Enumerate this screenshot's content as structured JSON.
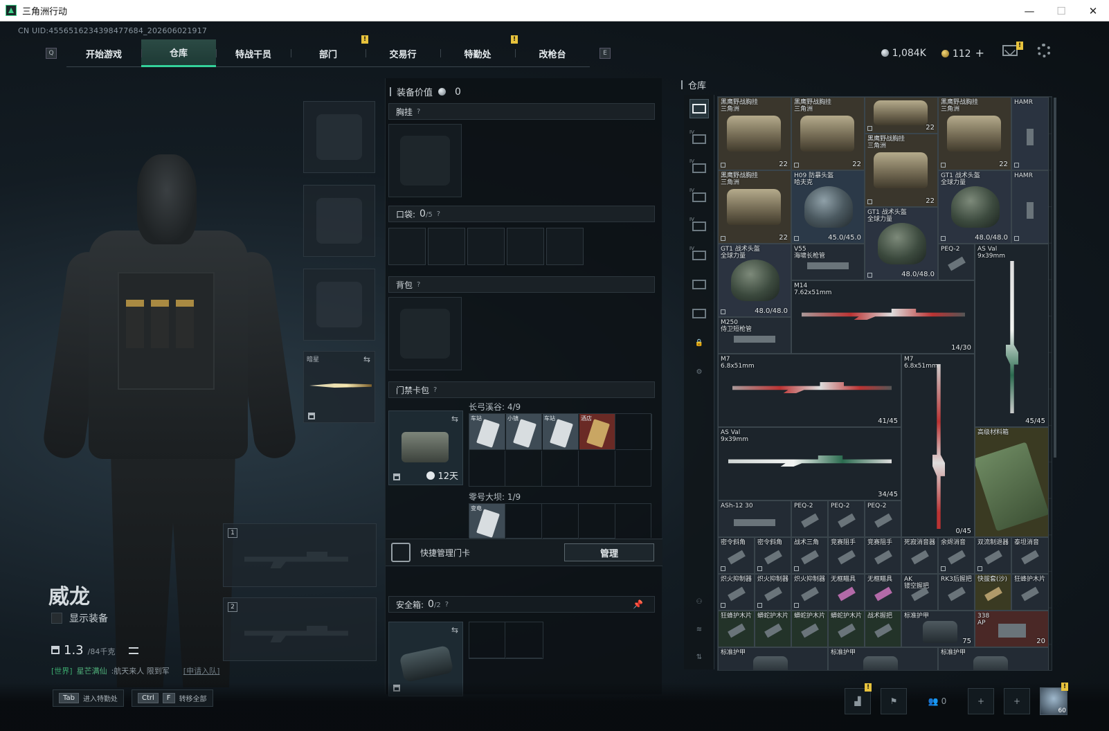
{
  "window": {
    "title": "三角洲行动",
    "minimize": "—",
    "maximize": "☐",
    "close": "✕"
  },
  "uid": "CN UID:4556516234398477684_202606021917",
  "nav": {
    "left_key": "Q",
    "right_key": "E",
    "tabs": [
      "开始游戏",
      "仓库",
      "特战干员",
      "部门",
      "交易行",
      "特勤处",
      "改枪台"
    ],
    "active_tab": "仓库",
    "badge": "!"
  },
  "currency": {
    "silver": "1,084K",
    "gold": "112",
    "plus": "+"
  },
  "operator": {
    "name": "威龙",
    "show_gear_label": "显示装备",
    "weight_value": "1.3",
    "weight_max": "/84千克"
  },
  "chat": {
    "channel": "[世界]",
    "sender": "星芒满仙",
    "message": ":航天来人 限到军",
    "link": "[申请入队]"
  },
  "hotkeys": [
    {
      "keys": [
        "Tab"
      ],
      "label": "进入特勤处"
    },
    {
      "keys": [
        "Ctrl",
        "F"
      ],
      "label": "转移全部"
    }
  ],
  "bottom": {
    "friends": "0",
    "level": "60"
  },
  "slots": {
    "knife_label": "暗星",
    "weapon1": "1",
    "weapon2": "2"
  },
  "equipment": {
    "header": "装备价值",
    "value": "0",
    "chest": "胸挂",
    "pockets": "口袋:",
    "pockets_count": "0",
    "pockets_max": "/5",
    "backpack": "背包",
    "keybag": "门禁卡包",
    "keybag_timer": "12天",
    "map1": "长弓溪谷: 4/9",
    "map2": "零号大坝: 1/9",
    "keycards_map1": [
      "车站",
      "小镇",
      "车站",
      "酒店"
    ],
    "keycards_map2": [
      "变电"
    ],
    "quick_manage": "快捷管理门卡",
    "manage_button": "管理",
    "safebox": "安全箱:",
    "safebox_count": "0",
    "safebox_max": "/2",
    "question": "?"
  },
  "stash": {
    "title": "仓库",
    "items": [
      {
        "name": "黑鹰野战胸挂\n三角洲",
        "stack": "22"
      },
      {
        "name": "黑鹰野战胸挂\n三角洲",
        "stack": "22"
      },
      {
        "name": "黑鹰野战胸挂\n三角洲",
        "stack": "22"
      },
      {
        "name": "黑鹰野战胸挂\n三角洲",
        "stack": "22"
      },
      {
        "name": "HAMR",
        "stack": ""
      },
      {
        "name": "黑鹰野战胸挂\n三角洲",
        "stack": "22"
      },
      {
        "name": "H09 防暴头盔\n哈夫克",
        "stack": "45.0/45.0"
      },
      {
        "name": "黑鹰野战胸挂\n三角洲",
        "stack": "22"
      },
      {
        "name": "GT1 战术头盔\n全球力量",
        "stack": "48.0/48.0"
      },
      {
        "name": "HAMR",
        "stack": ""
      },
      {
        "name": "GT1 战术头盔\n全球力量",
        "stack": "48.0/48.0"
      },
      {
        "name": "GT1 战术头盔\n全球力量",
        "stack": "48.0/48.0"
      },
      {
        "name": "V55\n海啸长枪管",
        "stack": ""
      },
      {
        "name": "PEQ-2",
        "stack": ""
      },
      {
        "name": "AS Val\n9x39mm",
        "stack": "45/45"
      },
      {
        "name": "M14\n7.62x51mm",
        "stack": "14/30"
      },
      {
        "name": "M250\n侍卫短枪管",
        "stack": ""
      },
      {
        "name": "M7\n6.8x51mm",
        "stack": "41/45"
      },
      {
        "name": "M7\n6.8x51mm",
        "stack": "0/45"
      },
      {
        "name": "AS Val\n9x39mm",
        "stack": "34/45"
      },
      {
        "name": "高级材料箱",
        "stack": ""
      },
      {
        "name": "ASh-12 30",
        "stack": ""
      },
      {
        "name": "PEQ-2",
        "stack": ""
      },
      {
        "name": "PEQ-2",
        "stack": ""
      },
      {
        "name": "PEQ-2",
        "stack": ""
      },
      {
        "name": "密令斜角",
        "stack": ""
      },
      {
        "name": "密令斜角",
        "stack": ""
      },
      {
        "name": "战术三角",
        "stack": ""
      },
      {
        "name": "竞赛阻手",
        "stack": ""
      },
      {
        "name": "竞赛阻手",
        "stack": ""
      },
      {
        "name": "死寂消音器",
        "stack": ""
      },
      {
        "name": "余烬消音",
        "stack": ""
      },
      {
        "name": "双流制退器",
        "stack": ""
      },
      {
        "name": "泰坦消音",
        "stack": ""
      },
      {
        "name": "炽火抑制器",
        "stack": ""
      },
      {
        "name": "炽火抑制器",
        "stack": ""
      },
      {
        "name": "炽火抑制器",
        "stack": ""
      },
      {
        "name": "无框瞄具",
        "stack": ""
      },
      {
        "name": "无框瞄具",
        "stack": ""
      },
      {
        "name": "AK\n镂空握把",
        "stack": ""
      },
      {
        "name": "RK3后握把",
        "stack": ""
      },
      {
        "name": "快拔套(沙)",
        "stack": ""
      },
      {
        "name": "狂蜂护木片",
        "stack": ""
      },
      {
        "name": "狂蜂护木片",
        "stack": ""
      },
      {
        "name": "蟒蛇护木片",
        "stack": ""
      },
      {
        "name": "蟒蛇护木片",
        "stack": ""
      },
      {
        "name": "蟒蛇护木片",
        "stack": ""
      },
      {
        "name": "战术握把",
        "stack": ""
      },
      {
        "name": "标准护甲",
        "stack": "75"
      },
      {
        "name": "338\nAP",
        "stack": "20"
      },
      {
        "name": "标准护甲",
        "stack": ""
      },
      {
        "name": "标准护甲",
        "stack": ""
      },
      {
        "name": "标准护甲",
        "stack": ""
      }
    ]
  },
  "colors": {
    "accent": "#34d19a",
    "badge": "#e7c23c",
    "panel": "#151c21"
  }
}
